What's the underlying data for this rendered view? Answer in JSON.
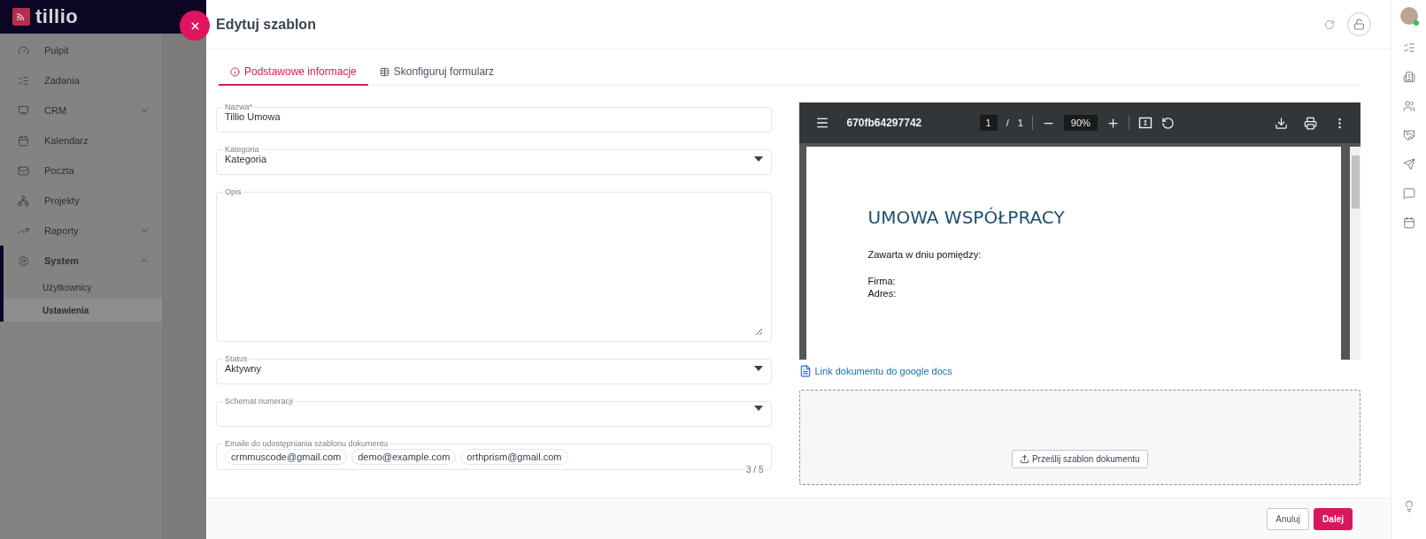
{
  "sidebar": {
    "logo": "tillio",
    "items": [
      {
        "label": "Pulpit"
      },
      {
        "label": "Zadania"
      },
      {
        "label": "CRM",
        "expanded": false
      },
      {
        "label": "Kalendarz"
      },
      {
        "label": "Poczta"
      },
      {
        "label": "Projekty"
      },
      {
        "label": "Raporty",
        "expanded": false
      },
      {
        "label": "System",
        "expanded": true,
        "selected": true,
        "children": [
          {
            "label": "Użytkownicy",
            "selected": false
          },
          {
            "label": "Ustawienia",
            "selected": true
          }
        ]
      }
    ]
  },
  "modal": {
    "title": "Edytuj szablon",
    "tabs": [
      {
        "label": "Podstawowe informacje",
        "selected": true
      },
      {
        "label": "Skonfiguruj formularz",
        "selected": false
      }
    ],
    "fields": [
      {
        "kind": "text",
        "label": "Nazwa*",
        "value": "Tillio Umowa"
      },
      {
        "kind": "select",
        "label": "Kategoria",
        "value": "Kategoria"
      },
      {
        "kind": "textarea",
        "label": "Opis"
      },
      {
        "kind": "select",
        "label": "Status",
        "value": "Aktywny"
      },
      {
        "kind": "select",
        "label": "Schemat numeracji"
      },
      {
        "kind": "chips",
        "label": "Emaile do udostępniania szablonu dokumentu",
        "chips": [
          "crmmuscode@gmail.com",
          "demo@example.com",
          "orthprism@gmail.com"
        ],
        "counter": "3 / 5"
      }
    ],
    "pdf_viewer": {
      "filename": "670fb64297742",
      "page": "1",
      "separator": "/",
      "total": "1",
      "zoom": "90%",
      "document": {
        "heading": "UMOWA WSPÓŁPRACY",
        "lines": [
          "Zawarta w dniu  pomiędzy:",
          "Firma:",
          "Adres:"
        ]
      }
    },
    "google_docs_link": "Link dokumentu do google docs",
    "upload_button": "Prześlij szablon dokumentu",
    "buttons": [
      {
        "label": "Anuluj",
        "kind": "secondary"
      },
      {
        "label": "Dalej",
        "kind": "primary"
      }
    ]
  },
  "user": {
    "online": true
  }
}
